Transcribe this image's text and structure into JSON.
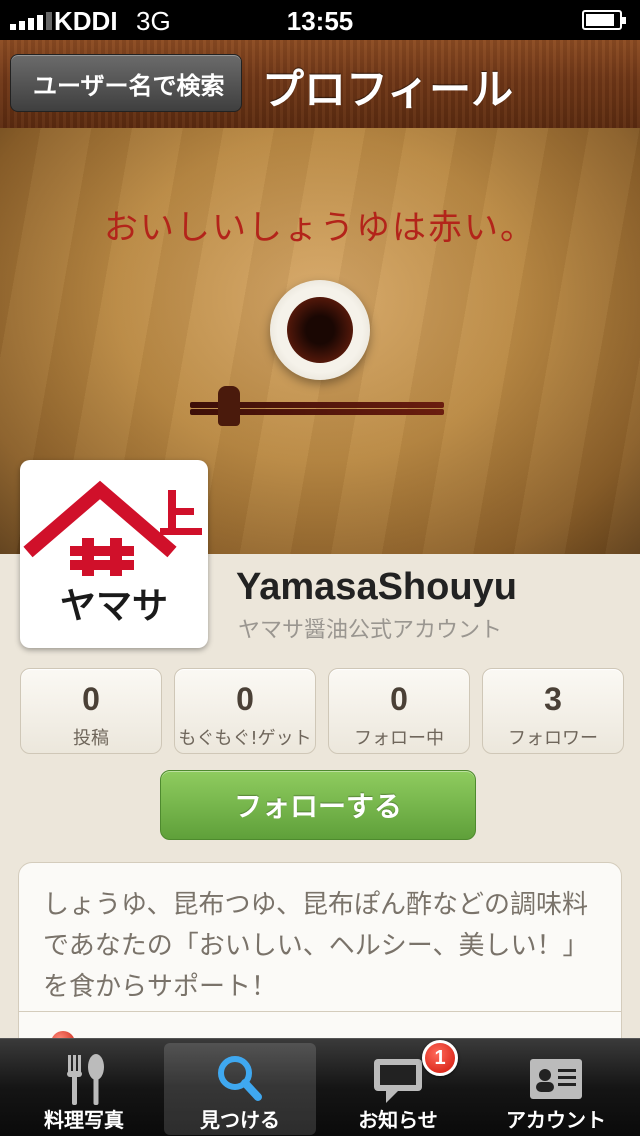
{
  "status_bar": {
    "carrier": "KDDI",
    "network": "3G",
    "time": "13:55"
  },
  "nav": {
    "back_label": "ユーザー名で検索",
    "title": "プロフィール"
  },
  "banner": {
    "tagline": "おいしいしょうゆは赤い。"
  },
  "profile": {
    "logo_text": "ヤマサ",
    "username": "YamasaShouyu",
    "subtitle": "ヤマサ醤油公式アカウント"
  },
  "stats": [
    {
      "value": "0",
      "label": "投稿"
    },
    {
      "value": "0",
      "label": "もぐもぐ!ゲット"
    },
    {
      "value": "0",
      "label": "フォロー中"
    },
    {
      "value": "3",
      "label": "フォロワー"
    }
  ],
  "follow_button": {
    "label": "フォローする"
  },
  "bio": {
    "text": "しょうゆ、昆布つゆ、昆布ぽん酢などの調味料であなたの「おいしい、ヘルシー、美しい！」を食からサポート！"
  },
  "tabbar": {
    "tabs": [
      {
        "label": "料理写真",
        "icon": "fork-spoon-icon"
      },
      {
        "label": "見つける",
        "icon": "search-icon"
      },
      {
        "label": "お知らせ",
        "icon": "message-icon"
      },
      {
        "label": "アカウント",
        "icon": "id-card-icon"
      }
    ],
    "notification_badge": "1"
  },
  "colors": {
    "follow_green": "#6fb046",
    "tagline_red": "#b3241a",
    "logo_red": "#d0102a"
  }
}
